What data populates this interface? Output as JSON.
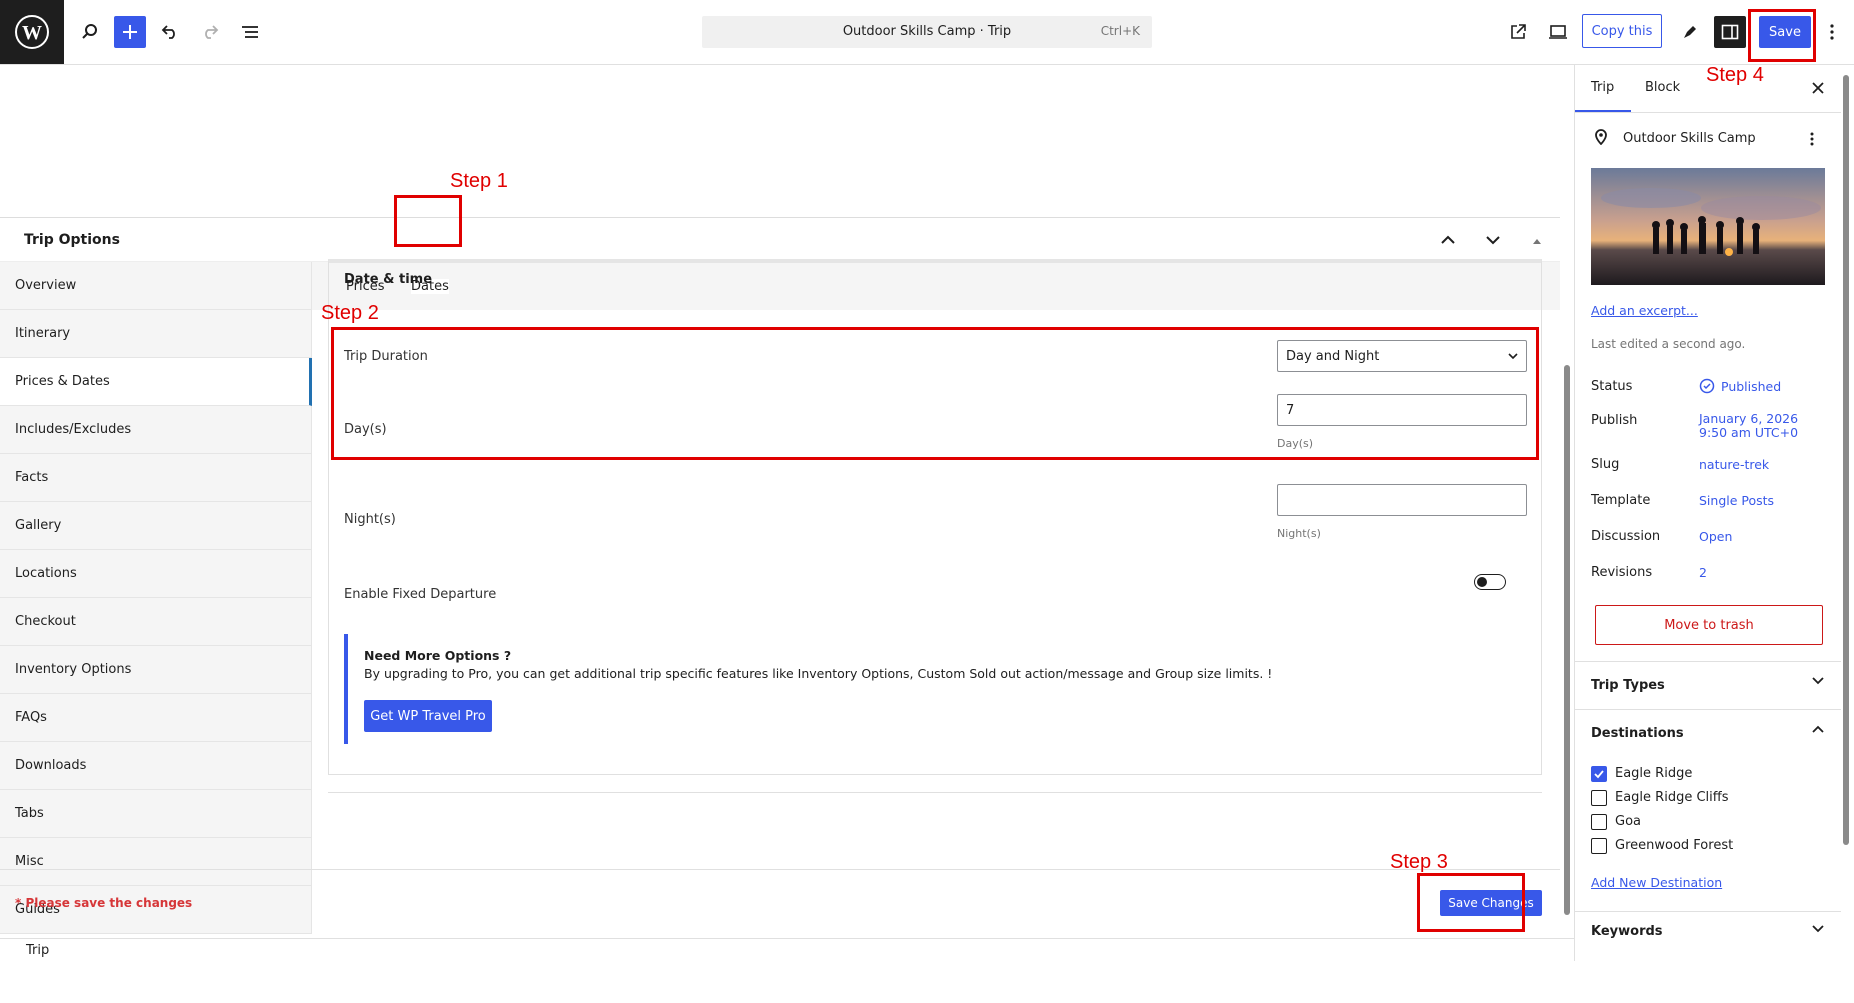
{
  "topbar": {
    "command_title": "Outdoor Skills Camp · Trip",
    "command_shortcut": "Ctrl+K",
    "copy_label": "Copy this",
    "save_label": "Save"
  },
  "annotations": {
    "step1": "Step 1",
    "step2": "Step 2",
    "step3": "Step 3",
    "step4": "Step 4"
  },
  "meta_box": {
    "title": "Trip Options",
    "nav": [
      "Overview",
      "Itinerary",
      "Prices & Dates",
      "Includes/Excludes",
      "Facts",
      "Gallery",
      "Locations",
      "Checkout",
      "Inventory Options",
      "FAQs",
      "Downloads",
      "Tabs",
      "Misc",
      "Guides"
    ],
    "active_nav": "Prices & Dates",
    "tabs": [
      "Prices",
      "Dates"
    ],
    "section_title": "Date & time",
    "trip_duration_label": "Trip Duration",
    "trip_duration_value": "Day and Night",
    "days_label": "Day(s)",
    "days_value": "7",
    "days_help": "Day(s)",
    "nights_label": "Night(s)",
    "nights_value": "",
    "nights_help": "Night(s)",
    "fixed_departure_label": "Enable Fixed Departure",
    "pro_title": "Need More Options ?",
    "pro_text": "By upgrading to Pro, you can get additional trip specific features like Inventory Options, Custom Sold out action/message and Group size limits. !",
    "pro_button": "Get WP Travel Pro",
    "warning": "* Please save the changes",
    "save_changes": "Save Changes"
  },
  "footer": {
    "breadcrumb": "Trip"
  },
  "sidebar": {
    "tabs": [
      "Trip",
      "Block"
    ],
    "post_title": "Outdoor Skills Camp",
    "excerpt_link": "Add an excerpt...",
    "last_edited": "Last edited a second ago.",
    "rows": [
      {
        "label": "Status",
        "value": "Published"
      },
      {
        "label": "Publish",
        "value": "January 6, 2026",
        "value2": "9:50 am UTC+0"
      },
      {
        "label": "Slug",
        "value": "nature-trek"
      },
      {
        "label": "Template",
        "value": "Single Posts"
      },
      {
        "label": "Discussion",
        "value": "Open"
      },
      {
        "label": "Revisions",
        "value": "2"
      }
    ],
    "trash_label": "Move to trash",
    "trip_types": "Trip Types",
    "destinations": "Destinations",
    "destination_items": [
      {
        "label": "Eagle Ridge",
        "checked": true
      },
      {
        "label": "Eagle Ridge Cliffs",
        "checked": false
      },
      {
        "label": "Goa",
        "checked": false
      },
      {
        "label": "Greenwood Forest",
        "checked": false
      }
    ],
    "add_destination": "Add New Destination",
    "keywords": "Keywords"
  }
}
